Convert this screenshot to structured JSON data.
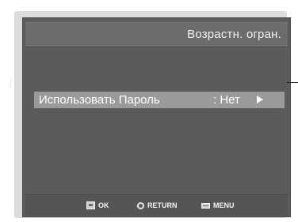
{
  "header": {
    "title": "Возрастн. огран."
  },
  "menu": {
    "items": [
      {
        "label": "Использовать Пароль",
        "value": ": Нет",
        "arrow_icon": "right-triangle-icon"
      }
    ]
  },
  "footer": {
    "hints": [
      {
        "icon": "ok-icon",
        "label": "OK"
      },
      {
        "icon": "return-icon",
        "label": "RETURN"
      },
      {
        "icon": "menu-icon",
        "label": "MENU"
      }
    ]
  },
  "colors": {
    "screen_bg": "#5b5b5b",
    "title_bar": "#6c6c6c",
    "highlight": "#9a9a9a",
    "bezel": "#dcdcdc",
    "text": "#ffffff"
  }
}
